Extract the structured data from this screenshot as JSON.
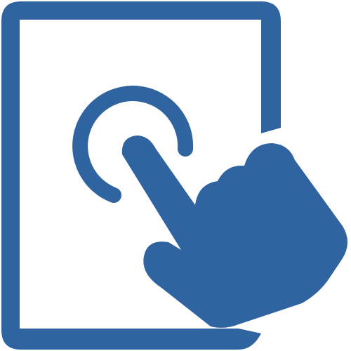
{
  "icon": {
    "name": "tablet-touch-icon",
    "parts": [
      "tablet-frame-icon",
      "tap-ripple-icon",
      "pointing-hand-icon",
      "home-button-icon"
    ]
  },
  "colors": {
    "primary": "#2F64A1",
    "background": "#FFFFFF"
  }
}
